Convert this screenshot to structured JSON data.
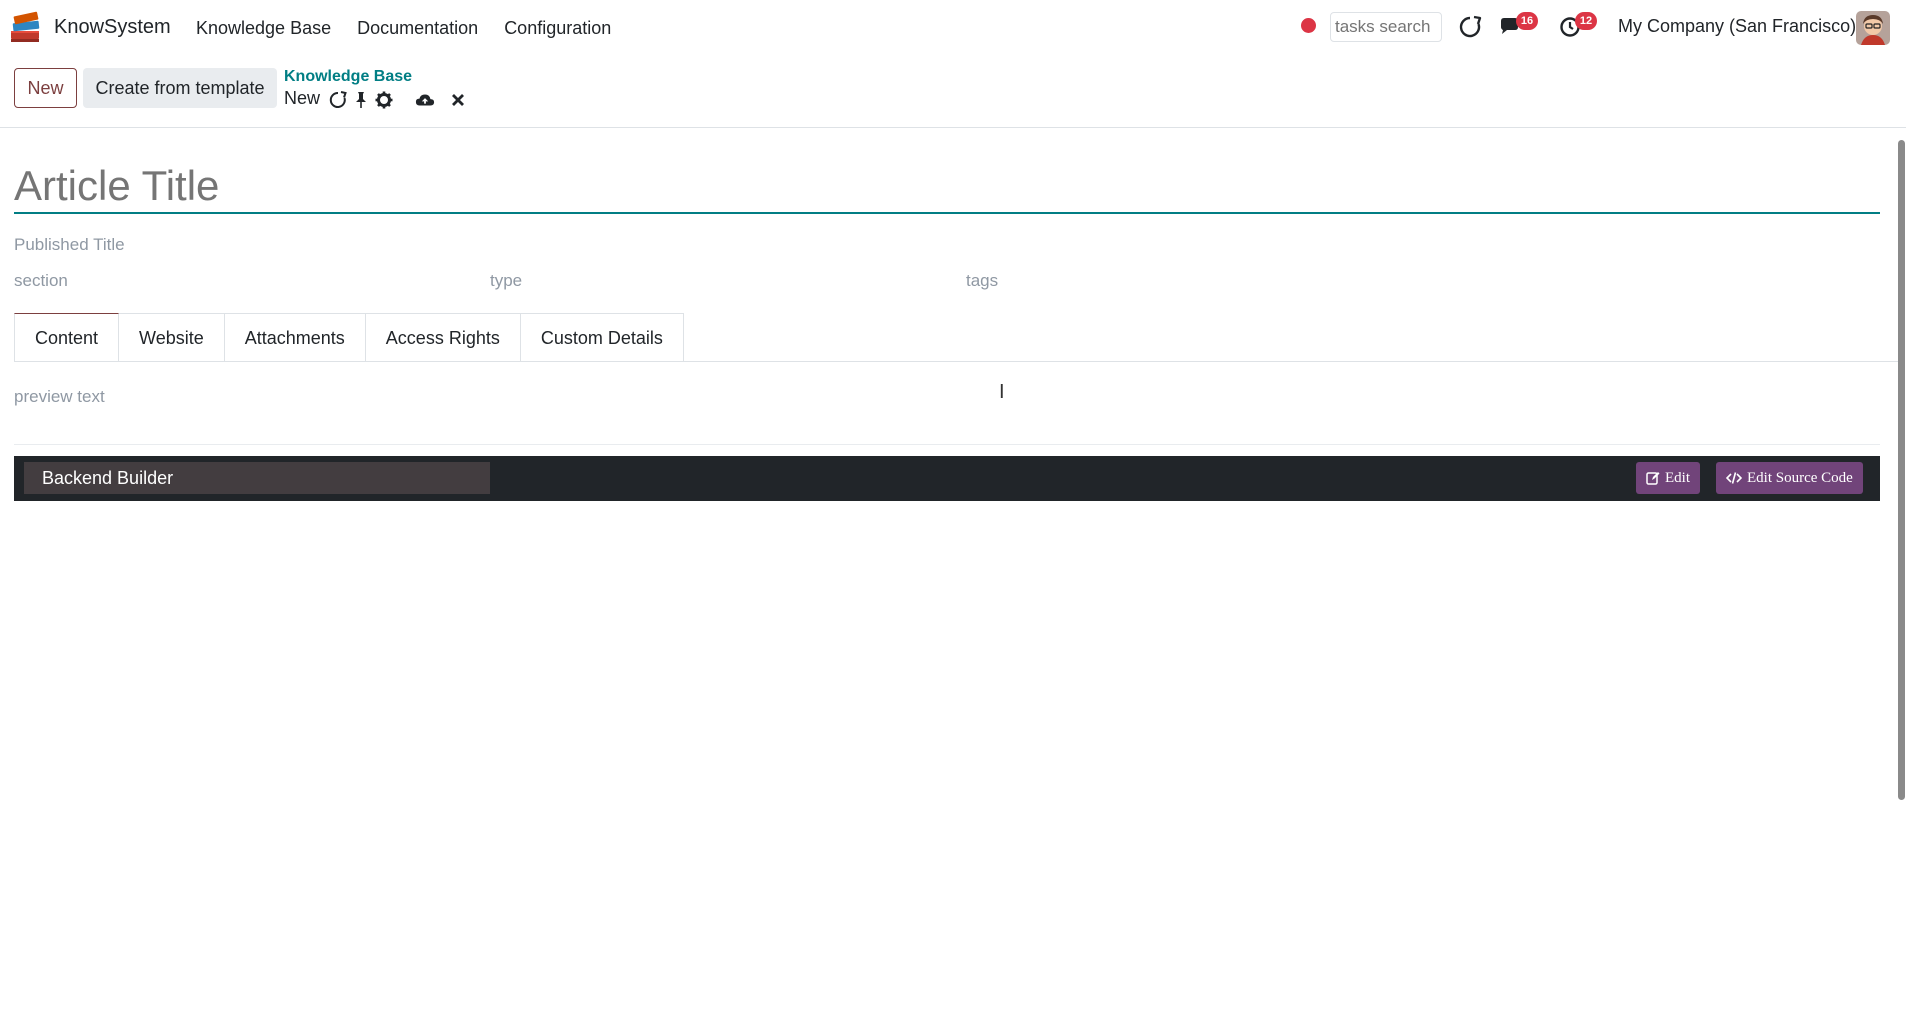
{
  "app": {
    "name": "KnowSystem",
    "menu": [
      "Knowledge Base",
      "Documentation",
      "Configuration"
    ]
  },
  "systray": {
    "search_placeholder": "tasks search",
    "messages_badge": "16",
    "activities_badge": "12",
    "company": "My Company (San Francisco)"
  },
  "control_panel": {
    "new_label": "New",
    "template_label": "Create from template",
    "breadcrumb_parent": "Knowledge Base",
    "breadcrumb_current": "New"
  },
  "form": {
    "title_placeholder": "Article Title",
    "published_title_placeholder": "Published Title",
    "section_placeholder": "section",
    "type_placeholder": "type",
    "tags_placeholder": "tags",
    "tabs": [
      "Content",
      "Website",
      "Attachments",
      "Access Rights",
      "Custom Details"
    ],
    "active_tab": "Content",
    "preview_placeholder": "preview text",
    "builder_label": "Backend Builder",
    "edit_label": "Edit",
    "edit_source_label": "Edit Source Code"
  },
  "colors": {
    "brand": "#7c3f3f",
    "link": "#017e84",
    "builder_button": "#71447a",
    "badge": "#dc3545"
  }
}
